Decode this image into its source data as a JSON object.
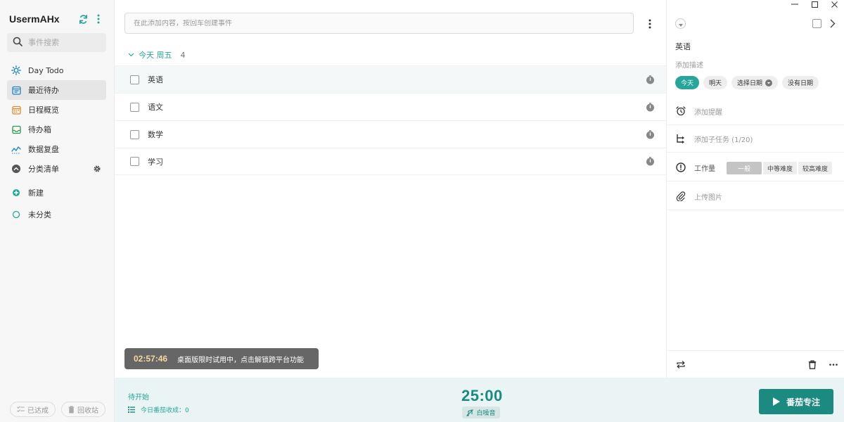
{
  "sidebar": {
    "username": "UsermAHx",
    "search_placeholder": "事件搜索",
    "nav": [
      {
        "label": "Day Todo"
      },
      {
        "label": "最近待办"
      },
      {
        "label": "日程概览"
      },
      {
        "label": "待办箱"
      },
      {
        "label": "数据复盘"
      },
      {
        "label": "分类清单"
      }
    ],
    "extra": [
      {
        "label": "新建"
      },
      {
        "label": "未分类"
      }
    ],
    "footer": {
      "done_label": "已达成",
      "trash_label": "回收站"
    }
  },
  "main": {
    "add_placeholder": "在此添加内容，按回车创建事件",
    "group": {
      "title": "今天 周五",
      "count": "4"
    },
    "tasks": [
      {
        "name": "英语"
      },
      {
        "name": "语文"
      },
      {
        "name": "数学"
      },
      {
        "name": "学习"
      }
    ],
    "toast": {
      "time": "02:57:46",
      "message": "桌面版限时试用中，点击解锁跨平台功能"
    }
  },
  "bottom": {
    "status": "待开始",
    "today_count": "今日番茄收成：0",
    "timer": "25:00",
    "noise_label": "白噪音",
    "focus_label": "番茄专注"
  },
  "detail": {
    "title": "英语",
    "desc_placeholder": "添加描述",
    "date_chips": [
      "今天",
      "明天",
      "选择日期",
      "没有日期"
    ],
    "reminder_label": "添加提醒",
    "subtask_label": "添加子任务 (1/20)",
    "workload_label": "工作量",
    "workload_options": [
      "一般",
      "中等难度",
      "较高难度"
    ],
    "upload_label": "上传图片"
  },
  "colors": {
    "accent": "#26a69a",
    "accent_dark": "#1b8b81",
    "toast_bg": "#666666"
  }
}
